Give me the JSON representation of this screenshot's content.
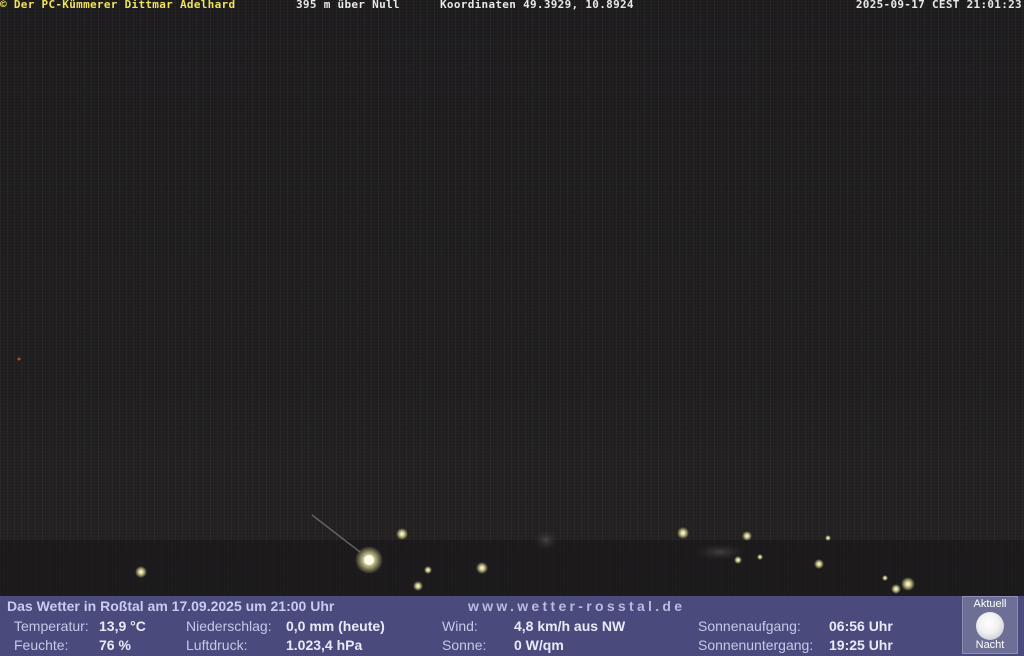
{
  "overlay": {
    "copyright": "© Der PC-Kümmerer Dittmar Adelhard",
    "altitude": "395 m über Null",
    "coordinates": "Koordinaten 49.3929, 10.8924",
    "timestamp": "2025-09-17 CEST 21:01:23"
  },
  "weather": {
    "title": "Das Wetter in Roßtal am 17.09.2025 um 21:00 Uhr",
    "url": "www.wetter-rosstal.de",
    "temperatur_label": "Temperatur:",
    "temperatur_value": "13,9 °C",
    "feuchte_label": "Feuchte:",
    "feuchte_value": "76 %",
    "niederschlag_label": "Niederschlag:",
    "niederschlag_value": "0,0 mm (heute)",
    "luftdruck_label": "Luftdruck:",
    "luftdruck_value": "1.023,4 hPa",
    "wind_label": "Wind:",
    "wind_value": "4,8 km/h aus NW",
    "sonne_label": "Sonne:",
    "sonne_value": "0 W/qm",
    "sonnenaufgang_label": "Sonnenaufgang:",
    "sonnenaufgang_value": "06:56 Uhr",
    "sonnenuntergang_label": "Sonnenuntergang:",
    "sonnenuntergang_value": "19:25 Uhr"
  },
  "moon": {
    "aktuell": "Aktuell",
    "nacht": "Nacht",
    "icon": "moon-icon"
  }
}
